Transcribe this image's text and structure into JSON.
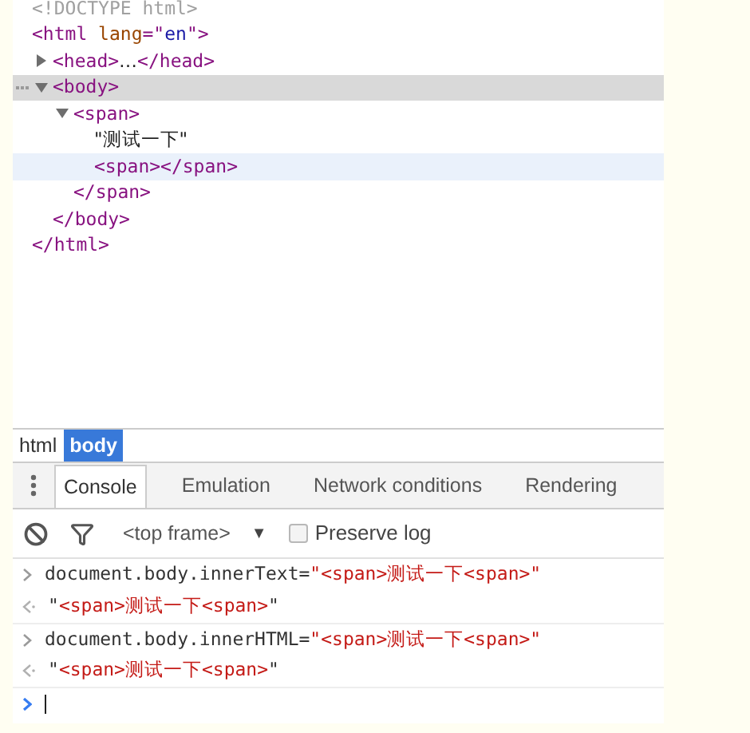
{
  "dom_tree": [
    {
      "tokens": [
        {
          "kind": "doctype",
          "text": "<!DOCTYPE html>"
        }
      ]
    },
    {
      "tokens": [
        {
          "kind": "tag",
          "text": "<html"
        },
        {
          "kind": "attr_name",
          "text": " lang"
        },
        {
          "kind": "tag",
          "text": "=\""
        },
        {
          "kind": "attr_value",
          "text": "en"
        },
        {
          "kind": "tag",
          "text": "\">"
        }
      ],
      "close": "</html>",
      "children": [
        {
          "expanded": false,
          "tokens": [
            {
              "kind": "tag",
              "text": "<head>"
            },
            {
              "kind": "text",
              "text": "…"
            },
            {
              "kind": "tag",
              "text": "</head>"
            }
          ]
        },
        {
          "expanded": true,
          "selected": true,
          "tokens": [
            {
              "kind": "tag",
              "text": "<body>"
            }
          ],
          "close": "</body>",
          "children": [
            {
              "expanded": true,
              "tokens": [
                {
                  "kind": "tag",
                  "text": "<span>"
                }
              ],
              "close": "</span>",
              "children": [
                {
                  "tokens": [
                    {
                      "kind": "text",
                      "text": "\"测试一下\""
                    }
                  ]
                },
                {
                  "hovered": true,
                  "tokens": [
                    {
                      "kind": "tag",
                      "text": "<span></span>"
                    }
                  ]
                }
              ]
            }
          ]
        }
      ]
    }
  ],
  "breadcrumbs": [
    {
      "label": "html",
      "selected": false
    },
    {
      "label": "body",
      "selected": true
    }
  ],
  "drawer_tabs": [
    {
      "label": "Console",
      "selected": true
    },
    {
      "label": "Emulation",
      "selected": false
    },
    {
      "label": "Network conditions",
      "selected": false
    },
    {
      "label": "Rendering",
      "selected": false
    }
  ],
  "toolbar": {
    "frame": "<top frame>",
    "dropdown_glyph": "▼",
    "preserve_log": {
      "label": "Preserve log",
      "checked": false
    }
  },
  "console": [
    {
      "kind": "input",
      "tokens": [
        {
          "kind": "code",
          "text": "document.body.innerText="
        },
        {
          "kind": "string",
          "text": "\"<span>测试一下<span>\""
        }
      ]
    },
    {
      "kind": "output",
      "tokens": [
        {
          "kind": "code",
          "text": "\""
        },
        {
          "kind": "string",
          "text": "<span>测试一下<span>"
        },
        {
          "kind": "code",
          "text": "\""
        }
      ]
    },
    {
      "kind": "input",
      "tokens": [
        {
          "kind": "code",
          "text": "document.body.innerHTML="
        },
        {
          "kind": "string",
          "text": "\"<span>测试一下<span>\""
        }
      ]
    },
    {
      "kind": "output",
      "tokens": [
        {
          "kind": "code",
          "text": "\""
        },
        {
          "kind": "string",
          "text": "<span>测试一下<span>"
        },
        {
          "kind": "code",
          "text": "\""
        }
      ]
    },
    {
      "kind": "prompt"
    }
  ]
}
